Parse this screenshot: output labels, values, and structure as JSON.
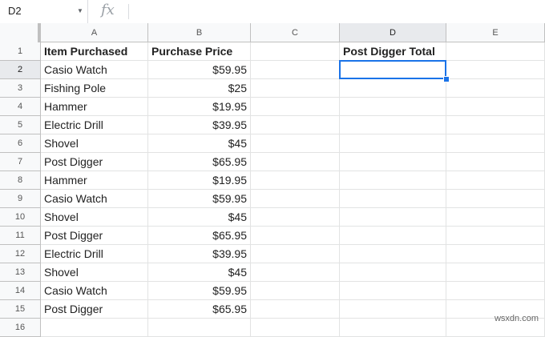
{
  "formula_bar": {
    "cell_ref": "D2",
    "fx_label": "fx",
    "formula": ""
  },
  "columns": [
    "A",
    "B",
    "C",
    "D",
    "E"
  ],
  "selected_cell": {
    "column": "D",
    "row": 2
  },
  "rows": [
    {
      "n": "1",
      "A": "Item Purchased",
      "B": "Purchase Price",
      "C": "",
      "D": "Post Digger Total",
      "E": ""
    },
    {
      "n": "2",
      "A": "Casio Watch",
      "B": "$59.95",
      "C": "",
      "D": "",
      "E": ""
    },
    {
      "n": "3",
      "A": "Fishing Pole",
      "B": "$25",
      "C": "",
      "D": "",
      "E": ""
    },
    {
      "n": "4",
      "A": "Hammer",
      "B": "$19.95",
      "C": "",
      "D": "",
      "E": ""
    },
    {
      "n": "5",
      "A": "Electric Drill",
      "B": "$39.95",
      "C": "",
      "D": "",
      "E": ""
    },
    {
      "n": "6",
      "A": "Shovel",
      "B": "$45",
      "C": "",
      "D": "",
      "E": ""
    },
    {
      "n": "7",
      "A": "Post Digger",
      "B": "$65.95",
      "C": "",
      "D": "",
      "E": ""
    },
    {
      "n": "8",
      "A": "Hammer",
      "B": "$19.95",
      "C": "",
      "D": "",
      "E": ""
    },
    {
      "n": "9",
      "A": "Casio Watch",
      "B": "$59.95",
      "C": "",
      "D": "",
      "E": ""
    },
    {
      "n": "10",
      "A": "Shovel",
      "B": "$45",
      "C": "",
      "D": "",
      "E": ""
    },
    {
      "n": "11",
      "A": "Post Digger",
      "B": "$65.95",
      "C": "",
      "D": "",
      "E": ""
    },
    {
      "n": "12",
      "A": "Electric Drill",
      "B": "$39.95",
      "C": "",
      "D": "",
      "E": ""
    },
    {
      "n": "13",
      "A": "Shovel",
      "B": "$45",
      "C": "",
      "D": "",
      "E": ""
    },
    {
      "n": "14",
      "A": "Casio Watch",
      "B": "$59.95",
      "C": "",
      "D": "",
      "E": ""
    },
    {
      "n": "15",
      "A": "Post Digger",
      "B": "$65.95",
      "C": "",
      "D": "",
      "E": ""
    },
    {
      "n": "16",
      "A": "",
      "B": "",
      "C": "",
      "D": "",
      "E": ""
    }
  ],
  "watermark": "wsxdn.com"
}
